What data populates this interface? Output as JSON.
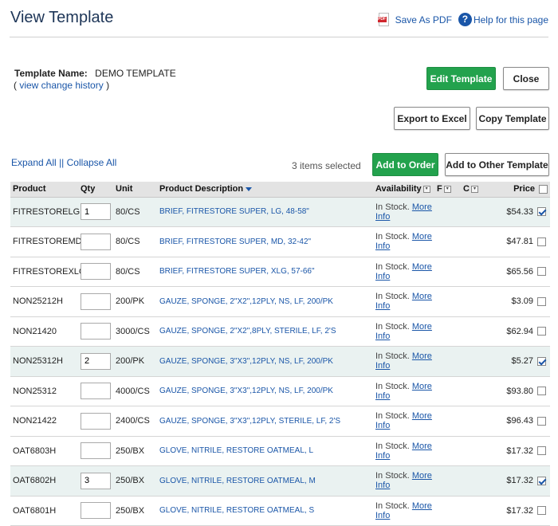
{
  "header": {
    "title": "View Template",
    "save_pdf_label": "Save As PDF",
    "help_label": "Help for this page"
  },
  "template": {
    "name_label": "Template Name:",
    "name_value": "DEMO TEMPLATE",
    "history_open": "(",
    "history_link": "view change history",
    "history_close": ")"
  },
  "buttons": {
    "edit": "Edit Template",
    "close": "Close",
    "export": "Export to Excel",
    "copy": "Copy Template",
    "add_order": "Add to Order",
    "add_other": "Add to Other Template"
  },
  "toolbar": {
    "expand_all": "Expand All",
    "separator": "||",
    "collapse_all": "Collapse All",
    "selected_count": "3 items selected"
  },
  "table": {
    "columns": {
      "product": "Product",
      "qty": "Qty",
      "unit": "Unit",
      "description": "Product Description",
      "availability": "Availability",
      "f": "F",
      "c": "C",
      "price": "Price"
    },
    "rows": [
      {
        "product": "FITRESTORELG",
        "qty": "1",
        "unit": "80/CS",
        "description": "BRIEF, FITRESTORE SUPER, LG, 48-58\"",
        "status": "In Stock.",
        "more": "More",
        "info": "Info",
        "price": "$54.33",
        "checked": true
      },
      {
        "product": "FITRESTOREMD",
        "qty": "",
        "unit": "80/CS",
        "description": "BRIEF, FITRESTORE SUPER, MD, 32-42\"",
        "status": "In Stock.",
        "more": "More",
        "info": "Info",
        "price": "$47.81",
        "checked": false
      },
      {
        "product": "FITRESTOREXLG",
        "qty": "",
        "unit": "80/CS",
        "description": "BRIEF, FITRESTORE SUPER, XLG, 57-66\"",
        "status": "In Stock.",
        "more": "More",
        "info": "Info",
        "price": "$65.56",
        "checked": false
      },
      {
        "product": "NON25212H",
        "qty": "",
        "unit": "200/PK",
        "description": "GAUZE, SPONGE, 2\"X2\",12PLY, NS, LF, 200/PK",
        "status": "In Stock.",
        "more": "More",
        "info": "Info",
        "price": "$3.09",
        "checked": false
      },
      {
        "product": "NON21420",
        "qty": "",
        "unit": "3000/CS",
        "description": "GAUZE, SPONGE, 2\"X2\",8PLY, STERILE, LF, 2'S",
        "status": "In Stock.",
        "more": "More",
        "info": "Info",
        "price": "$62.94",
        "checked": false
      },
      {
        "product": "NON25312H",
        "qty": "2",
        "unit": "200/PK",
        "description": "GAUZE, SPONGE, 3\"X3\",12PLY, NS, LF, 200/PK",
        "status": "In Stock.",
        "more": "More",
        "info": "Info",
        "price": "$5.27",
        "checked": true
      },
      {
        "product": "NON25312",
        "qty": "",
        "unit": "4000/CS",
        "description": "GAUZE, SPONGE, 3\"X3\",12PLY, NS, LF, 200/PK",
        "status": "In Stock.",
        "more": "More",
        "info": "Info",
        "price": "$93.80",
        "checked": false
      },
      {
        "product": "NON21422",
        "qty": "",
        "unit": "2400/CS",
        "description": "GAUZE, SPONGE, 3\"X3\",12PLY, STERILE, LF, 2'S",
        "status": "In Stock.",
        "more": "More",
        "info": "Info",
        "price": "$96.43",
        "checked": false
      },
      {
        "product": "OAT6803H",
        "qty": "",
        "unit": "250/BX",
        "description": "GLOVE, NITRILE, RESTORE OATMEAL, L",
        "status": "In Stock.",
        "more": "More",
        "info": "Info",
        "price": "$17.32",
        "checked": false
      },
      {
        "product": "OAT6802H",
        "qty": "3",
        "unit": "250/BX",
        "description": "GLOVE, NITRILE, RESTORE OATMEAL, M",
        "status": "In Stock.",
        "more": "More",
        "info": "Info",
        "price": "$17.32",
        "checked": true
      },
      {
        "product": "OAT6801H",
        "qty": "",
        "unit": "250/BX",
        "description": "GLOVE, NITRILE, RESTORE OATMEAL, S",
        "status": "In Stock.",
        "more": "More",
        "info": "Info",
        "price": "$17.32",
        "checked": false
      }
    ]
  }
}
